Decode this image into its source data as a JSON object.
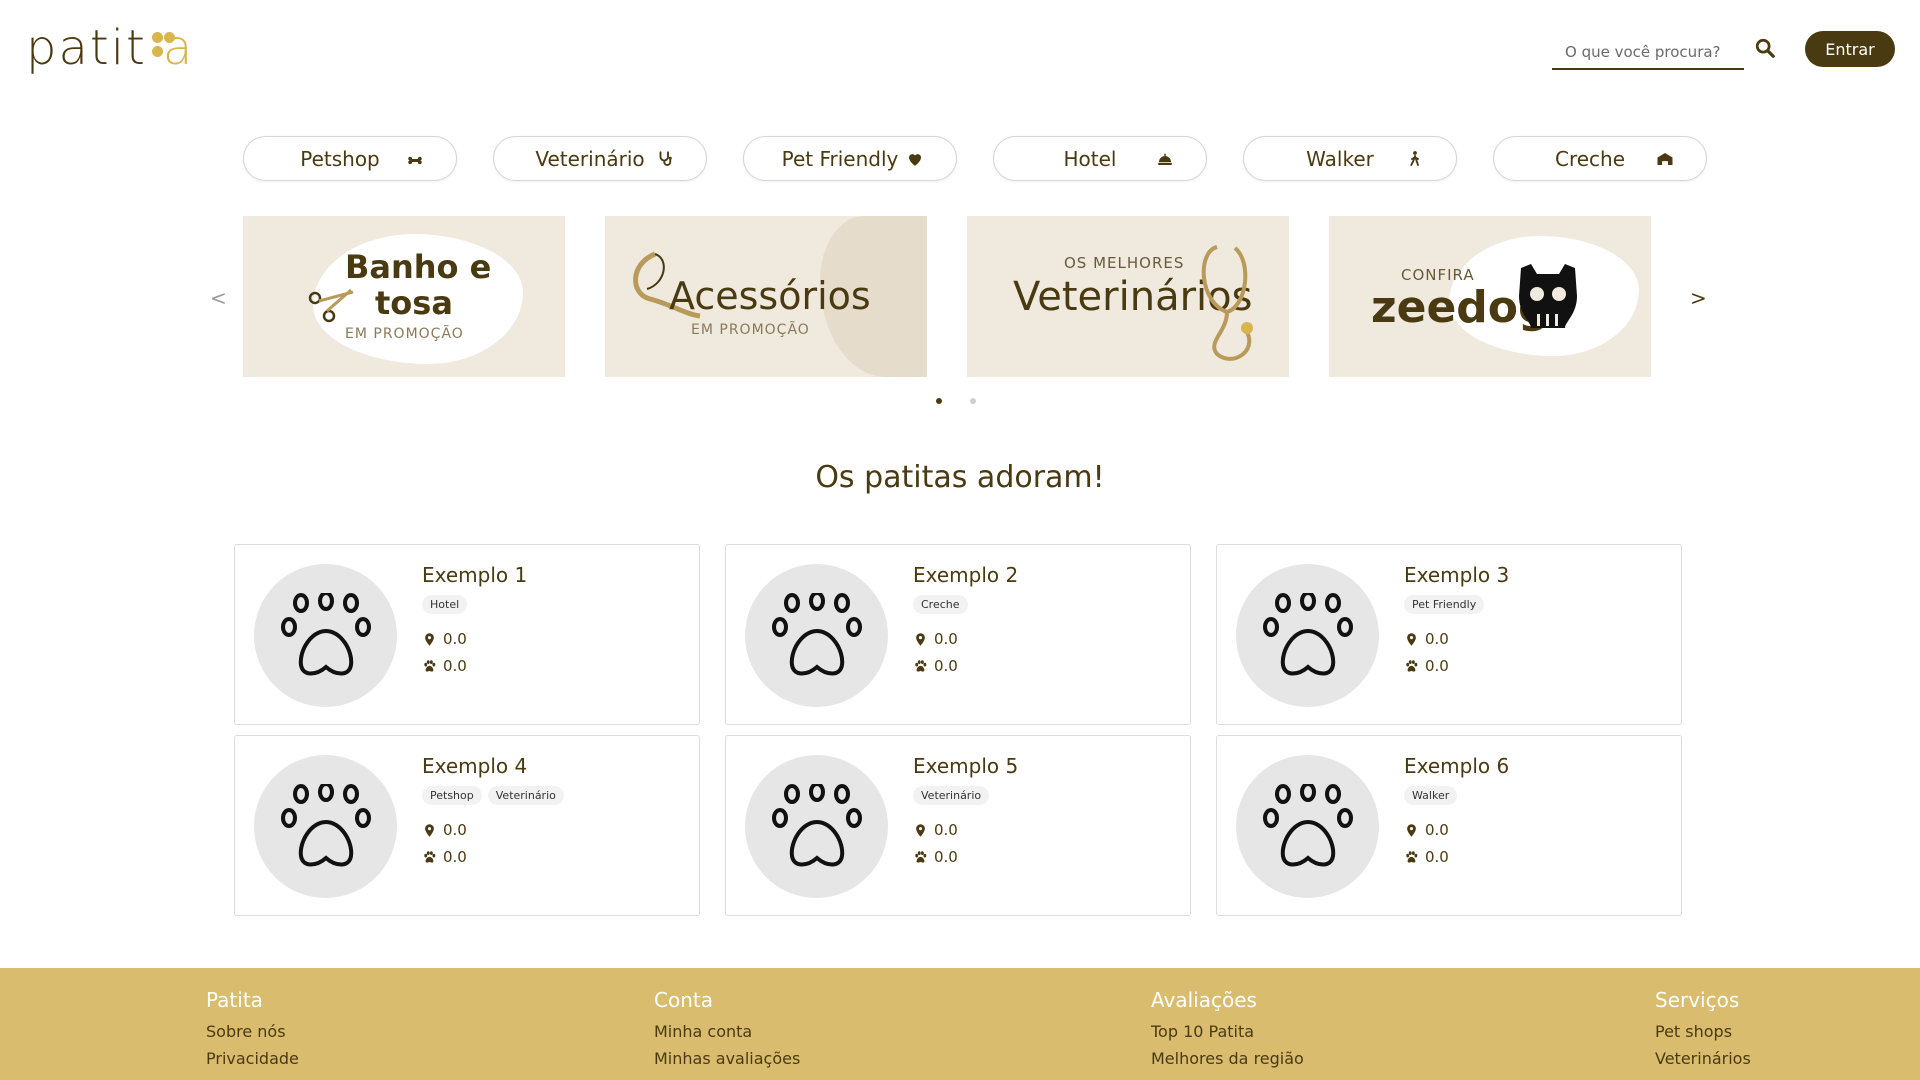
{
  "brand": {
    "logo_text": "patit",
    "logo_tail": "a"
  },
  "search": {
    "placeholder": "O que você procura?"
  },
  "login_label": "Entrar",
  "categories": [
    {
      "label": "Petshop",
      "icon": "bone-icon"
    },
    {
      "label": "Veterinário",
      "icon": "stethoscope-icon"
    },
    {
      "label": "Pet Friendly",
      "icon": "heart-icon"
    },
    {
      "label": "Hotel",
      "icon": "service-bell-icon"
    },
    {
      "label": "Walker",
      "icon": "walking-person-icon"
    },
    {
      "label": "Creche",
      "icon": "school-icon"
    }
  ],
  "carousel": {
    "prev": "<",
    "next": ">",
    "banners": [
      {
        "line1": "Banho e",
        "line2": "tosa",
        "sub": "EM PROMOÇÃO"
      },
      {
        "line1": "Acessórios",
        "sub": "EM PROMOÇÃO"
      },
      {
        "pre": "OS MELHORES",
        "line1": "Veterinários"
      },
      {
        "pre": "CONFIRA",
        "line1": "zeedog"
      }
    ]
  },
  "section_title": "Os patitas adoram!",
  "cards": [
    {
      "name": "Exemplo 1",
      "tags": [
        "Hotel"
      ],
      "distance": "0.0",
      "rating": "0.0"
    },
    {
      "name": "Exemplo 2",
      "tags": [
        "Creche"
      ],
      "distance": "0.0",
      "rating": "0.0"
    },
    {
      "name": "Exemplo 3",
      "tags": [
        "Pet Friendly"
      ],
      "distance": "0.0",
      "rating": "0.0"
    },
    {
      "name": "Exemplo 4",
      "tags": [
        "Petshop",
        "Veterinário"
      ],
      "distance": "0.0",
      "rating": "0.0"
    },
    {
      "name": "Exemplo 5",
      "tags": [
        "Veterinário"
      ],
      "distance": "0.0",
      "rating": "0.0"
    },
    {
      "name": "Exemplo 6",
      "tags": [
        "Walker"
      ],
      "distance": "0.0",
      "rating": "0.0"
    }
  ],
  "footer": {
    "columns": [
      {
        "title": "Patita",
        "links": [
          "Sobre nós",
          "Privacidade"
        ]
      },
      {
        "title": "Conta",
        "links": [
          "Minha conta",
          "Minhas avaliações"
        ]
      },
      {
        "title": "Avaliações",
        "links": [
          "Top 10 Patita",
          "Melhores da região"
        ]
      },
      {
        "title": "Serviços",
        "links": [
          "Pet shops",
          "Veterinários"
        ]
      }
    ]
  },
  "colors": {
    "primary": "#4a3a12",
    "accent": "#d9b54e",
    "footer_bg": "#d9bc6e",
    "banner_bg": "#efe9de"
  }
}
